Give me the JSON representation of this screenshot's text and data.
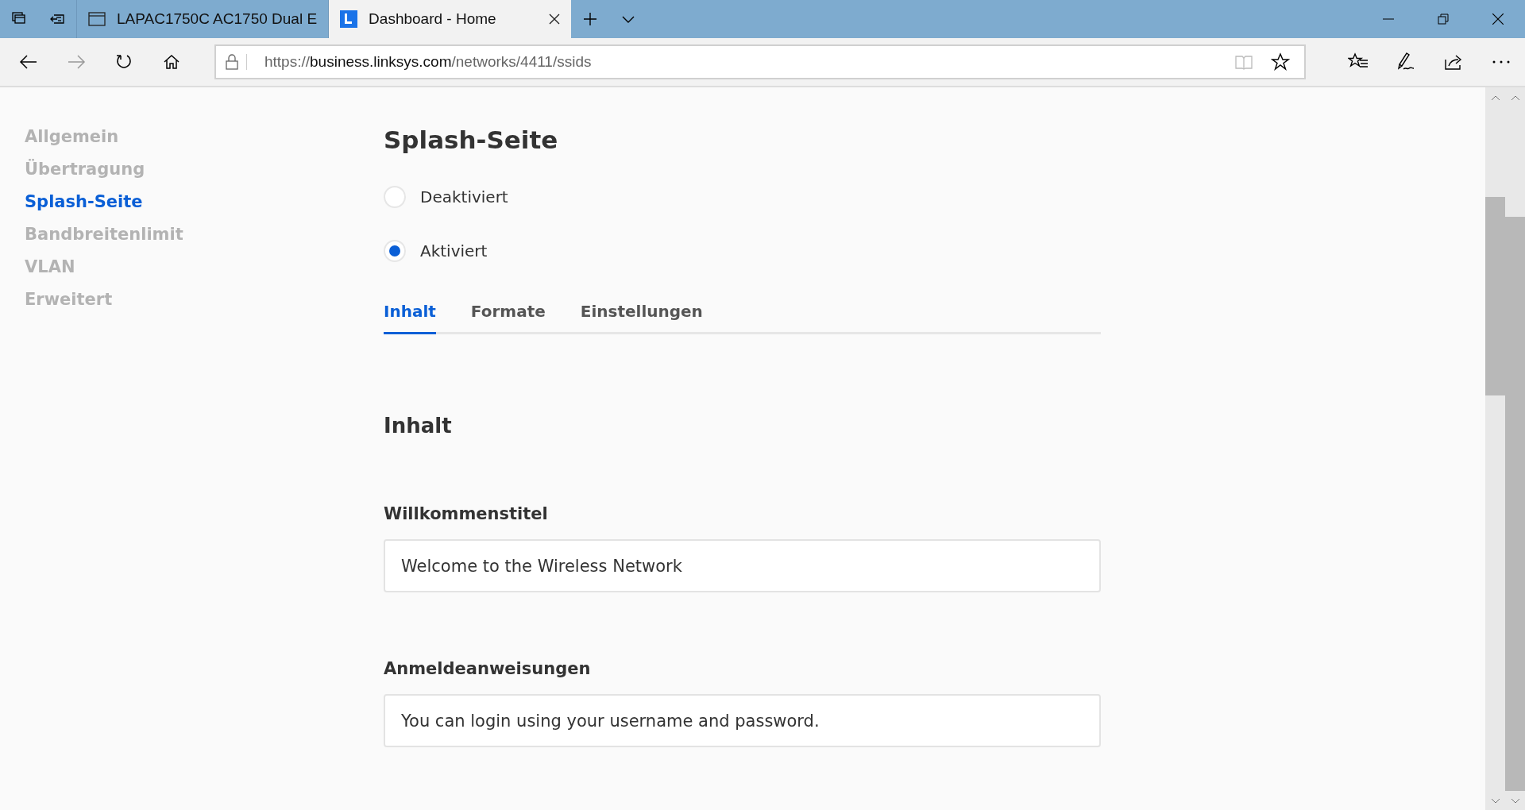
{
  "browser": {
    "tabs": [
      {
        "title": "LAPAC1750C AC1750 Dual E",
        "selected": false,
        "kind": "page"
      },
      {
        "title": "Dashboard - Home",
        "selected": true,
        "kind": "site"
      }
    ],
    "address": {
      "prefix": "https://",
      "host": "business.linksys.com",
      "path": "/networks/4411/ssids"
    }
  },
  "sidebar": {
    "items": [
      {
        "label": "Allgemein",
        "selected": false
      },
      {
        "label": "Übertragung",
        "selected": false
      },
      {
        "label": "Splash-Seite",
        "selected": true
      },
      {
        "label": "Bandbreitenlimit",
        "selected": false
      },
      {
        "label": "VLAN",
        "selected": false
      },
      {
        "label": "Erweitert",
        "selected": false
      }
    ]
  },
  "main": {
    "title": "Splash-Seite",
    "options": [
      {
        "label": "Deaktiviert",
        "selected": false
      },
      {
        "label": "Aktiviert",
        "selected": true
      }
    ],
    "tabs": [
      {
        "label": "Inhalt",
        "selected": true
      },
      {
        "label": "Formate",
        "selected": false
      },
      {
        "label": "Einstellungen",
        "selected": false
      }
    ],
    "section_title": "Inhalt",
    "fields": [
      {
        "label": "Willkommenstitel",
        "value": "Welcome to the Wireless Network"
      },
      {
        "label": "Anmeldeanweisungen",
        "value": "You can login using your username and password."
      }
    ]
  }
}
